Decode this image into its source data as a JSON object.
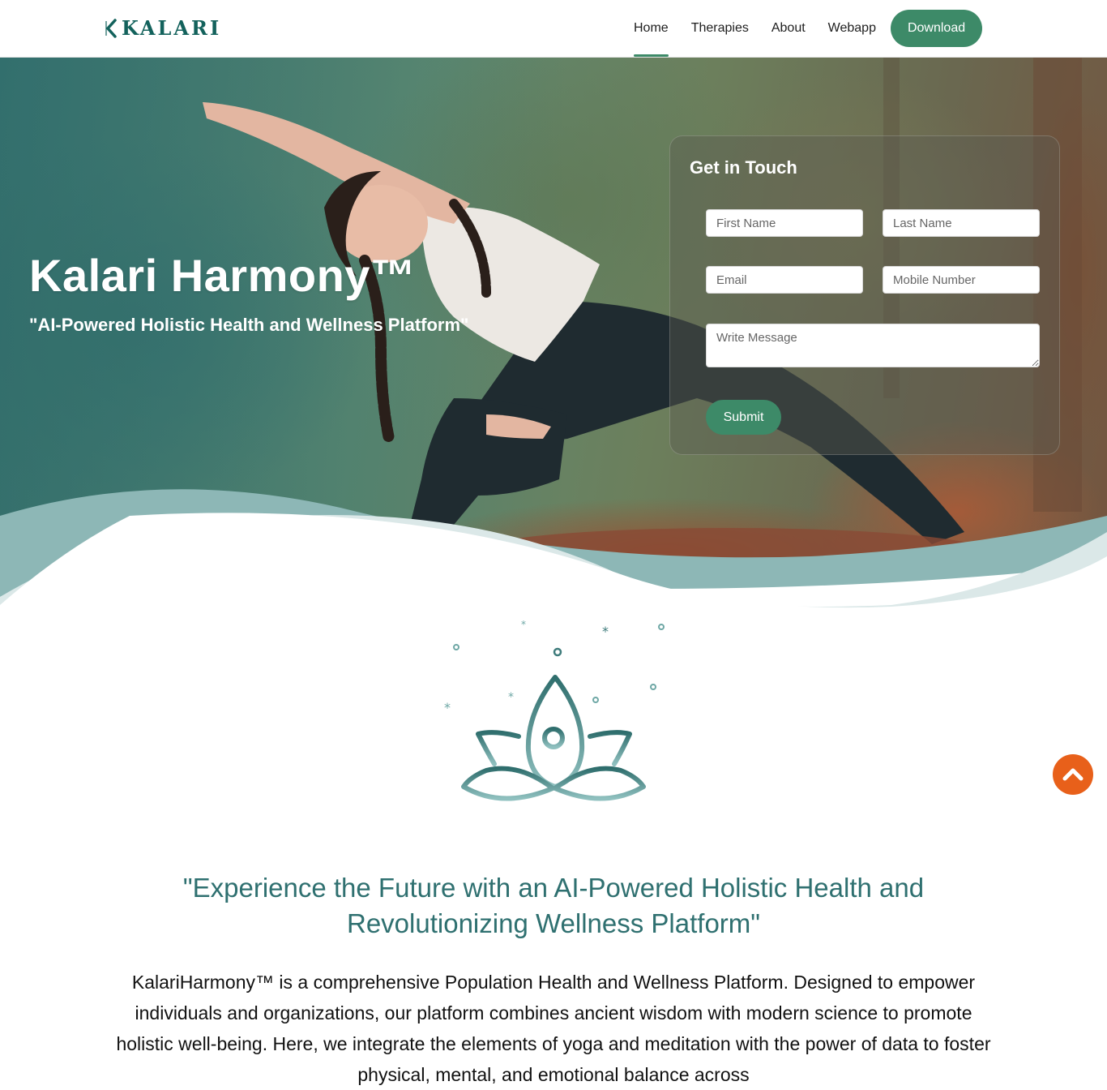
{
  "header": {
    "logo_text": "KALARI",
    "nav": [
      {
        "label": "Home",
        "active": true
      },
      {
        "label": "Therapies"
      },
      {
        "label": "About"
      },
      {
        "label": "Webapp"
      }
    ],
    "download_label": "Download"
  },
  "hero": {
    "title": "Kalari Harmony™",
    "subtitle": "\"AI-Powered Holistic Health and Wellness Platform\""
  },
  "contact_form": {
    "title": "Get in Touch",
    "first_name_placeholder": "First Name",
    "last_name_placeholder": "Last Name",
    "email_placeholder": "Email",
    "mobile_placeholder": "Mobile Number",
    "message_placeholder": "Write Message",
    "submit_label": "Submit"
  },
  "content": {
    "headline": "\"Experience the Future with an AI-Powered Holistic Health and Revolutionizing Wellness Platform\"",
    "body": "KalariHarmony™ is a comprehensive Population Health and Wellness Platform. Designed to empower individuals and organizations, our platform combines ancient wisdom with modern science to promote holistic well-being. Here, we integrate the elements of yoga and meditation with the power of data to foster physical, mental, and emotional balance across"
  },
  "colors": {
    "brand_green": "#3d8a68",
    "logo_teal": "#13625c",
    "headline_teal": "#2f7070",
    "scroll_top_orange": "#e8601a"
  },
  "icons": {
    "logo": "kalari-k-mark-icon",
    "lotus": "lotus-meditation-icon",
    "scroll_top": "chevron-up-icon"
  }
}
